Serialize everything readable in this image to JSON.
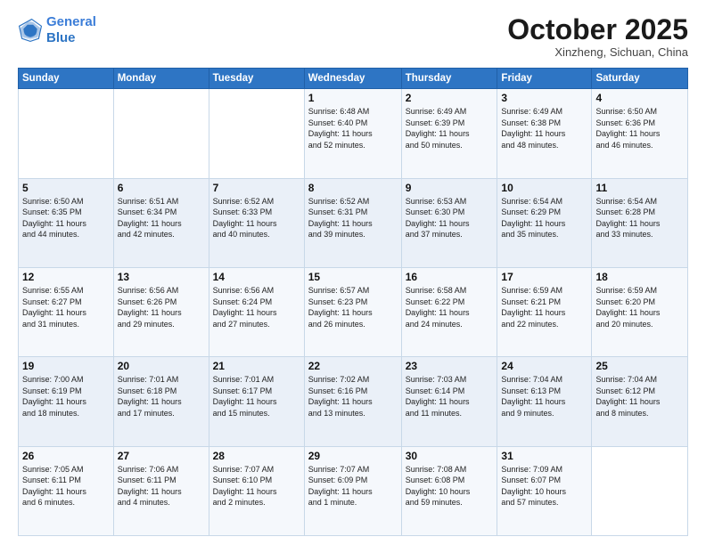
{
  "header": {
    "logo_line1": "General",
    "logo_line2": "Blue",
    "month_title": "October 2025",
    "location": "Xinzheng, Sichuan, China"
  },
  "weekdays": [
    "Sunday",
    "Monday",
    "Tuesday",
    "Wednesday",
    "Thursday",
    "Friday",
    "Saturday"
  ],
  "weeks": [
    [
      {
        "day": "",
        "info": ""
      },
      {
        "day": "",
        "info": ""
      },
      {
        "day": "",
        "info": ""
      },
      {
        "day": "1",
        "info": "Sunrise: 6:48 AM\nSunset: 6:40 PM\nDaylight: 11 hours\nand 52 minutes."
      },
      {
        "day": "2",
        "info": "Sunrise: 6:49 AM\nSunset: 6:39 PM\nDaylight: 11 hours\nand 50 minutes."
      },
      {
        "day": "3",
        "info": "Sunrise: 6:49 AM\nSunset: 6:38 PM\nDaylight: 11 hours\nand 48 minutes."
      },
      {
        "day": "4",
        "info": "Sunrise: 6:50 AM\nSunset: 6:36 PM\nDaylight: 11 hours\nand 46 minutes."
      }
    ],
    [
      {
        "day": "5",
        "info": "Sunrise: 6:50 AM\nSunset: 6:35 PM\nDaylight: 11 hours\nand 44 minutes."
      },
      {
        "day": "6",
        "info": "Sunrise: 6:51 AM\nSunset: 6:34 PM\nDaylight: 11 hours\nand 42 minutes."
      },
      {
        "day": "7",
        "info": "Sunrise: 6:52 AM\nSunset: 6:33 PM\nDaylight: 11 hours\nand 40 minutes."
      },
      {
        "day": "8",
        "info": "Sunrise: 6:52 AM\nSunset: 6:31 PM\nDaylight: 11 hours\nand 39 minutes."
      },
      {
        "day": "9",
        "info": "Sunrise: 6:53 AM\nSunset: 6:30 PM\nDaylight: 11 hours\nand 37 minutes."
      },
      {
        "day": "10",
        "info": "Sunrise: 6:54 AM\nSunset: 6:29 PM\nDaylight: 11 hours\nand 35 minutes."
      },
      {
        "day": "11",
        "info": "Sunrise: 6:54 AM\nSunset: 6:28 PM\nDaylight: 11 hours\nand 33 minutes."
      }
    ],
    [
      {
        "day": "12",
        "info": "Sunrise: 6:55 AM\nSunset: 6:27 PM\nDaylight: 11 hours\nand 31 minutes."
      },
      {
        "day": "13",
        "info": "Sunrise: 6:56 AM\nSunset: 6:26 PM\nDaylight: 11 hours\nand 29 minutes."
      },
      {
        "day": "14",
        "info": "Sunrise: 6:56 AM\nSunset: 6:24 PM\nDaylight: 11 hours\nand 27 minutes."
      },
      {
        "day": "15",
        "info": "Sunrise: 6:57 AM\nSunset: 6:23 PM\nDaylight: 11 hours\nand 26 minutes."
      },
      {
        "day": "16",
        "info": "Sunrise: 6:58 AM\nSunset: 6:22 PM\nDaylight: 11 hours\nand 24 minutes."
      },
      {
        "day": "17",
        "info": "Sunrise: 6:59 AM\nSunset: 6:21 PM\nDaylight: 11 hours\nand 22 minutes."
      },
      {
        "day": "18",
        "info": "Sunrise: 6:59 AM\nSunset: 6:20 PM\nDaylight: 11 hours\nand 20 minutes."
      }
    ],
    [
      {
        "day": "19",
        "info": "Sunrise: 7:00 AM\nSunset: 6:19 PM\nDaylight: 11 hours\nand 18 minutes."
      },
      {
        "day": "20",
        "info": "Sunrise: 7:01 AM\nSunset: 6:18 PM\nDaylight: 11 hours\nand 17 minutes."
      },
      {
        "day": "21",
        "info": "Sunrise: 7:01 AM\nSunset: 6:17 PM\nDaylight: 11 hours\nand 15 minutes."
      },
      {
        "day": "22",
        "info": "Sunrise: 7:02 AM\nSunset: 6:16 PM\nDaylight: 11 hours\nand 13 minutes."
      },
      {
        "day": "23",
        "info": "Sunrise: 7:03 AM\nSunset: 6:14 PM\nDaylight: 11 hours\nand 11 minutes."
      },
      {
        "day": "24",
        "info": "Sunrise: 7:04 AM\nSunset: 6:13 PM\nDaylight: 11 hours\nand 9 minutes."
      },
      {
        "day": "25",
        "info": "Sunrise: 7:04 AM\nSunset: 6:12 PM\nDaylight: 11 hours\nand 8 minutes."
      }
    ],
    [
      {
        "day": "26",
        "info": "Sunrise: 7:05 AM\nSunset: 6:11 PM\nDaylight: 11 hours\nand 6 minutes."
      },
      {
        "day": "27",
        "info": "Sunrise: 7:06 AM\nSunset: 6:11 PM\nDaylight: 11 hours\nand 4 minutes."
      },
      {
        "day": "28",
        "info": "Sunrise: 7:07 AM\nSunset: 6:10 PM\nDaylight: 11 hours\nand 2 minutes."
      },
      {
        "day": "29",
        "info": "Sunrise: 7:07 AM\nSunset: 6:09 PM\nDaylight: 11 hours\nand 1 minute."
      },
      {
        "day": "30",
        "info": "Sunrise: 7:08 AM\nSunset: 6:08 PM\nDaylight: 10 hours\nand 59 minutes."
      },
      {
        "day": "31",
        "info": "Sunrise: 7:09 AM\nSunset: 6:07 PM\nDaylight: 10 hours\nand 57 minutes."
      },
      {
        "day": "",
        "info": ""
      }
    ]
  ]
}
